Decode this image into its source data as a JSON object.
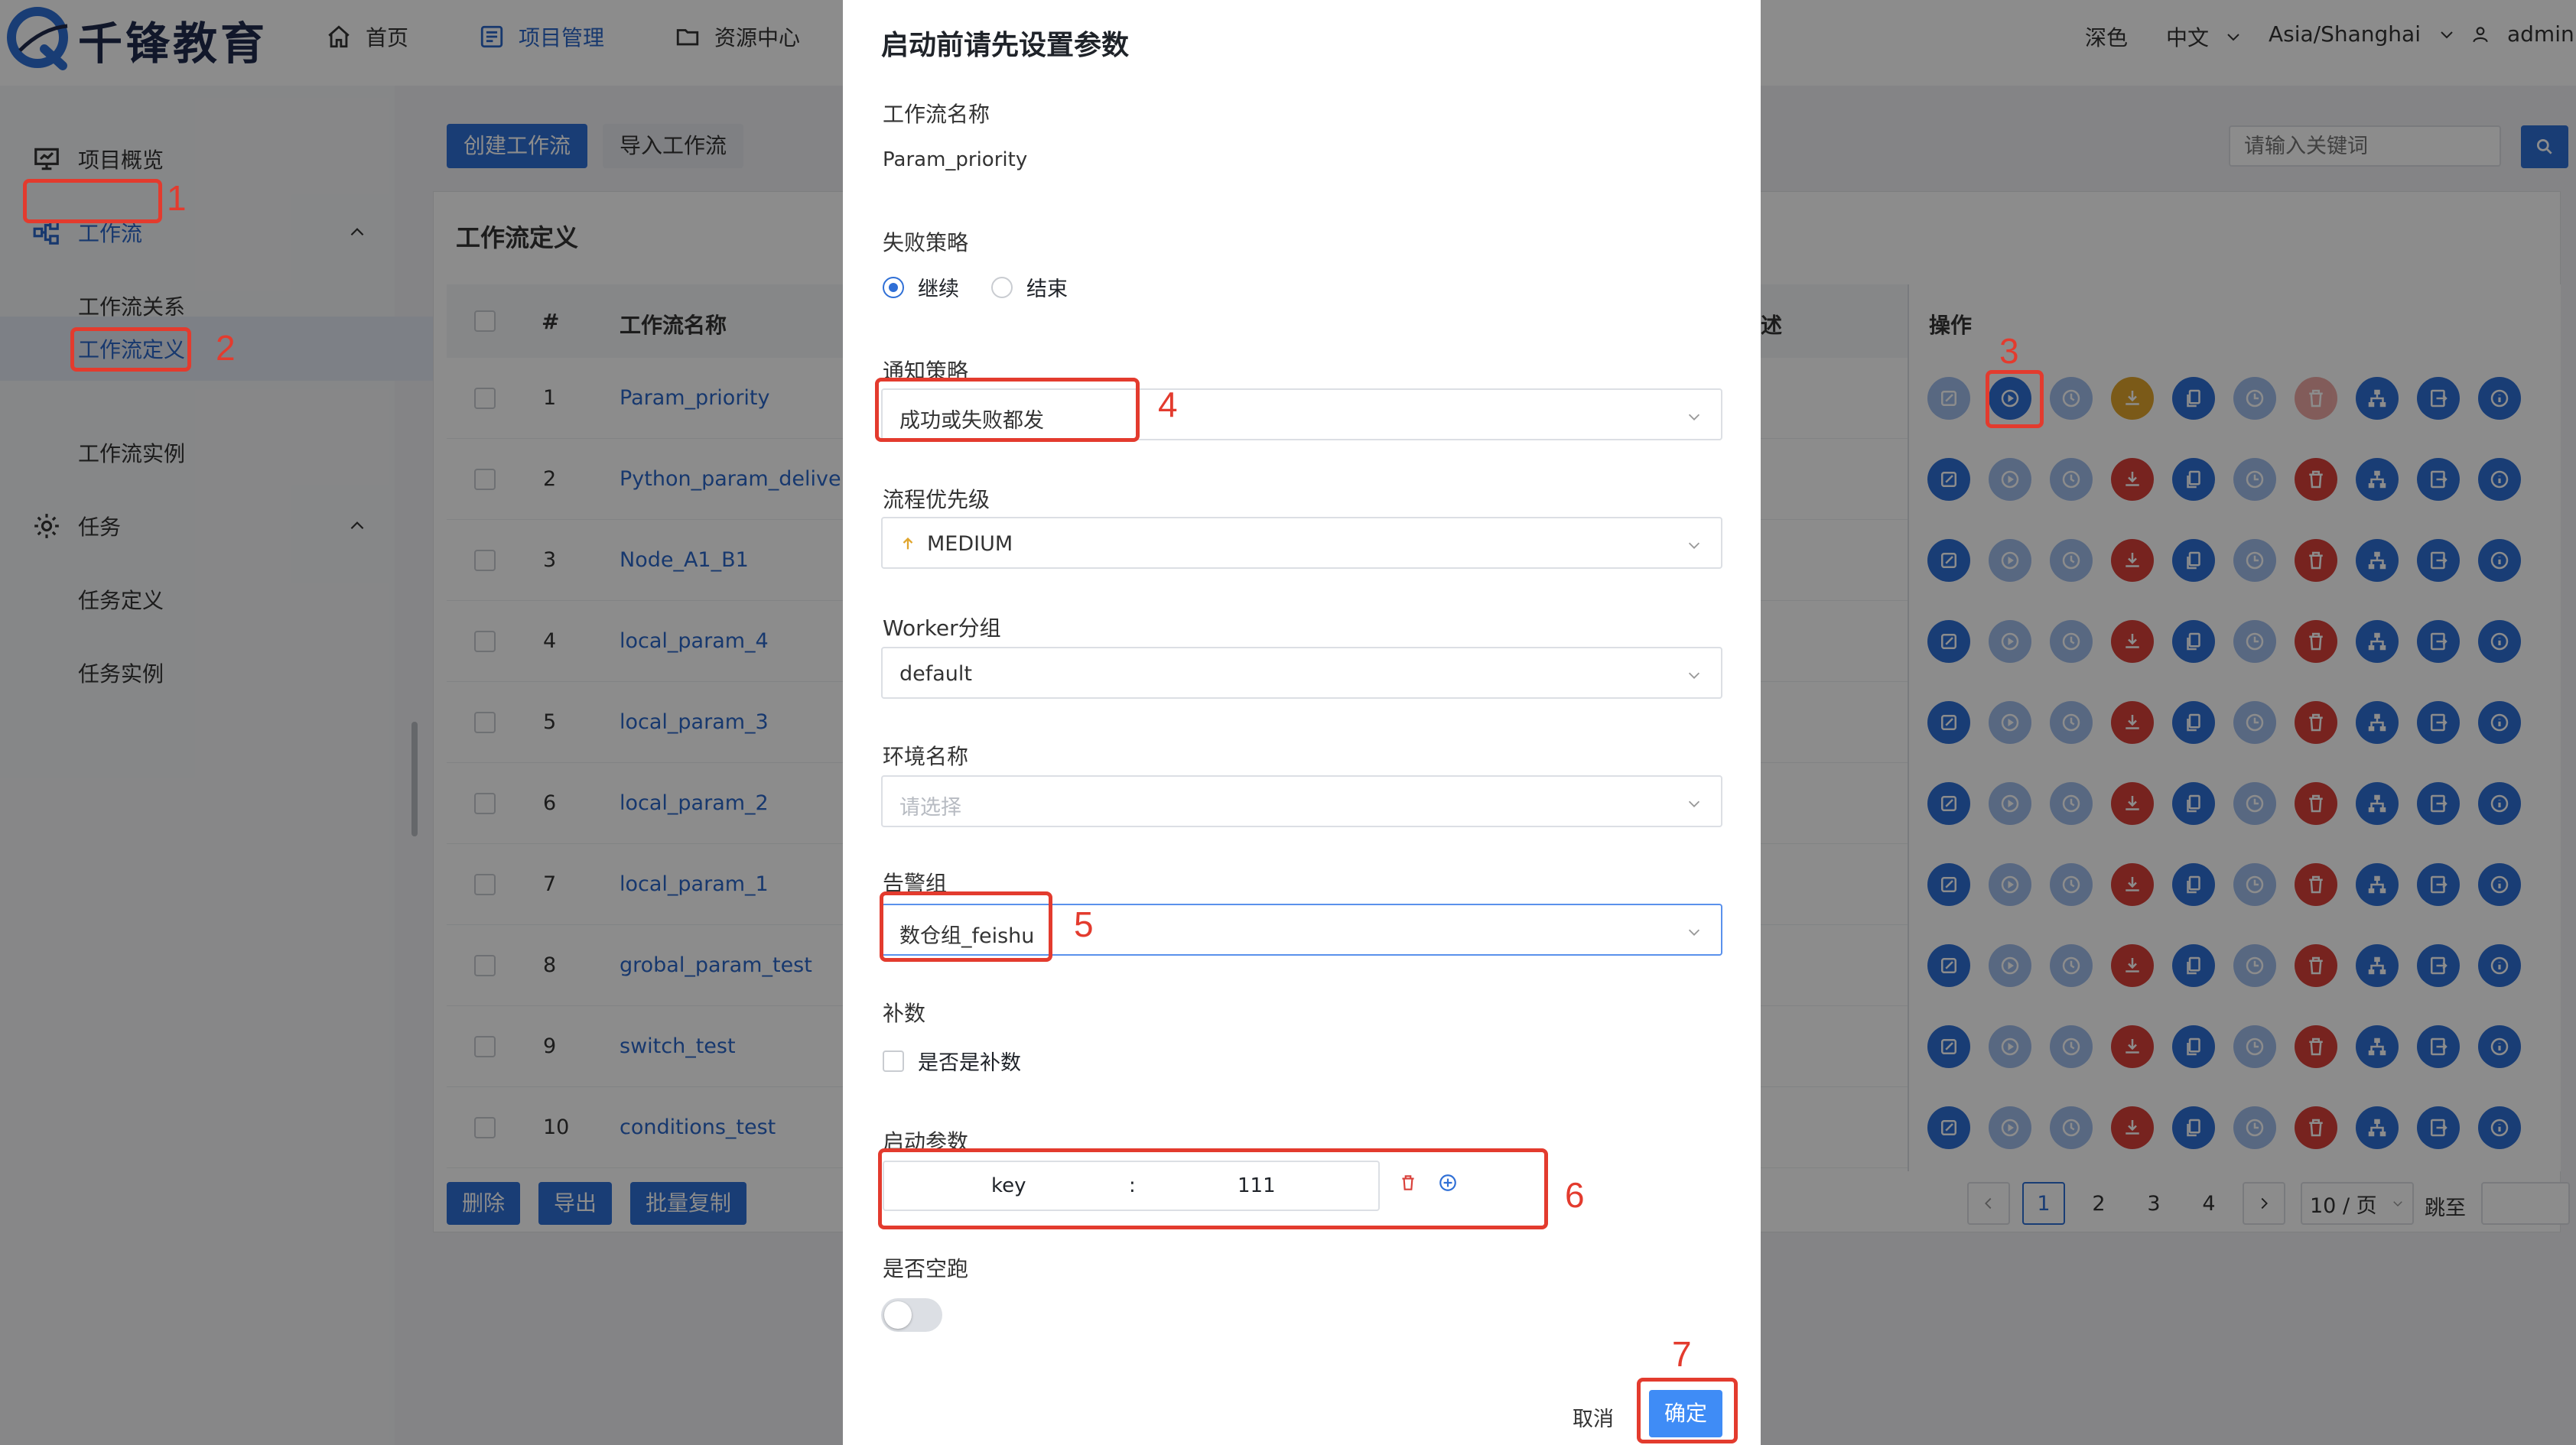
{
  "header": {
    "logo_text": "千锋教育",
    "nav": [
      {
        "label": "首页"
      },
      {
        "label": "项目管理"
      },
      {
        "label": "资源中心"
      }
    ],
    "theme": "深色",
    "language": "中文",
    "timezone": "Asia/Shanghai",
    "user": "admin"
  },
  "sidebar": {
    "items": [
      {
        "label": "项目概览"
      },
      {
        "label": "工作流"
      },
      {
        "label": "工作流关系"
      },
      {
        "label": "工作流定义"
      },
      {
        "label": "工作流实例"
      },
      {
        "label": "任务"
      },
      {
        "label": "任务定义"
      },
      {
        "label": "任务实例"
      }
    ]
  },
  "toolbar": {
    "create_label": "创建工作流",
    "import_label": "导入工作流",
    "search_placeholder": "请输入关键词"
  },
  "table": {
    "title": "工作流定义",
    "headers": [
      "#",
      "工作流名称",
      "述",
      "操作"
    ],
    "rows": [
      {
        "no": "1",
        "name": "Param_priority"
      },
      {
        "no": "2",
        "name": "Python_param_deliver"
      },
      {
        "no": "3",
        "name": "Node_A1_B1"
      },
      {
        "no": "4",
        "name": "local_param_4"
      },
      {
        "no": "5",
        "name": "local_param_3"
      },
      {
        "no": "6",
        "name": "local_param_2"
      },
      {
        "no": "7",
        "name": "local_param_1"
      },
      {
        "no": "8",
        "name": "grobal_param_test"
      },
      {
        "no": "9",
        "name": "switch_test"
      },
      {
        "no": "10",
        "name": "conditions_test"
      }
    ],
    "bottom_buttons": [
      "删除",
      "导出",
      "批量复制"
    ]
  },
  "pagination": {
    "pages": [
      "1",
      "2",
      "3",
      "4"
    ],
    "current": "1",
    "page_size": "10 / 页",
    "jump_label": "跳至"
  },
  "modal": {
    "title": "启动前请先设置参数",
    "workflow_name_label": "工作流名称",
    "workflow_name_value": "Param_priority",
    "failure_strategy_label": "失败策略",
    "failure_options": [
      "继续",
      "结束"
    ],
    "failure_selected": "继续",
    "notify_label": "通知策略",
    "notify_value": "成功或失败都发",
    "priority_label": "流程优先级",
    "priority_value": "MEDIUM",
    "worker_label": "Worker分组",
    "worker_value": "default",
    "env_label": "环境名称",
    "env_placeholder": "请选择",
    "alert_label": "告警组",
    "alert_value": "数仓组_feishu",
    "complement_label": "补数",
    "complement_checkbox": "是否是补数",
    "params_label": "启动参数",
    "param_key": "key",
    "param_sep": ":",
    "param_value": "111",
    "dry_run_label": "是否空跑",
    "dry_run_on": false,
    "cancel_label": "取消",
    "confirm_label": "确定"
  },
  "annotations": [
    "1",
    "2",
    "3",
    "4",
    "5",
    "6",
    "7"
  ],
  "colors": {
    "primary": "#2f6fd6",
    "danger": "#d9403a",
    "warning": "#e0a52c",
    "annotation": "#e33b2e"
  }
}
